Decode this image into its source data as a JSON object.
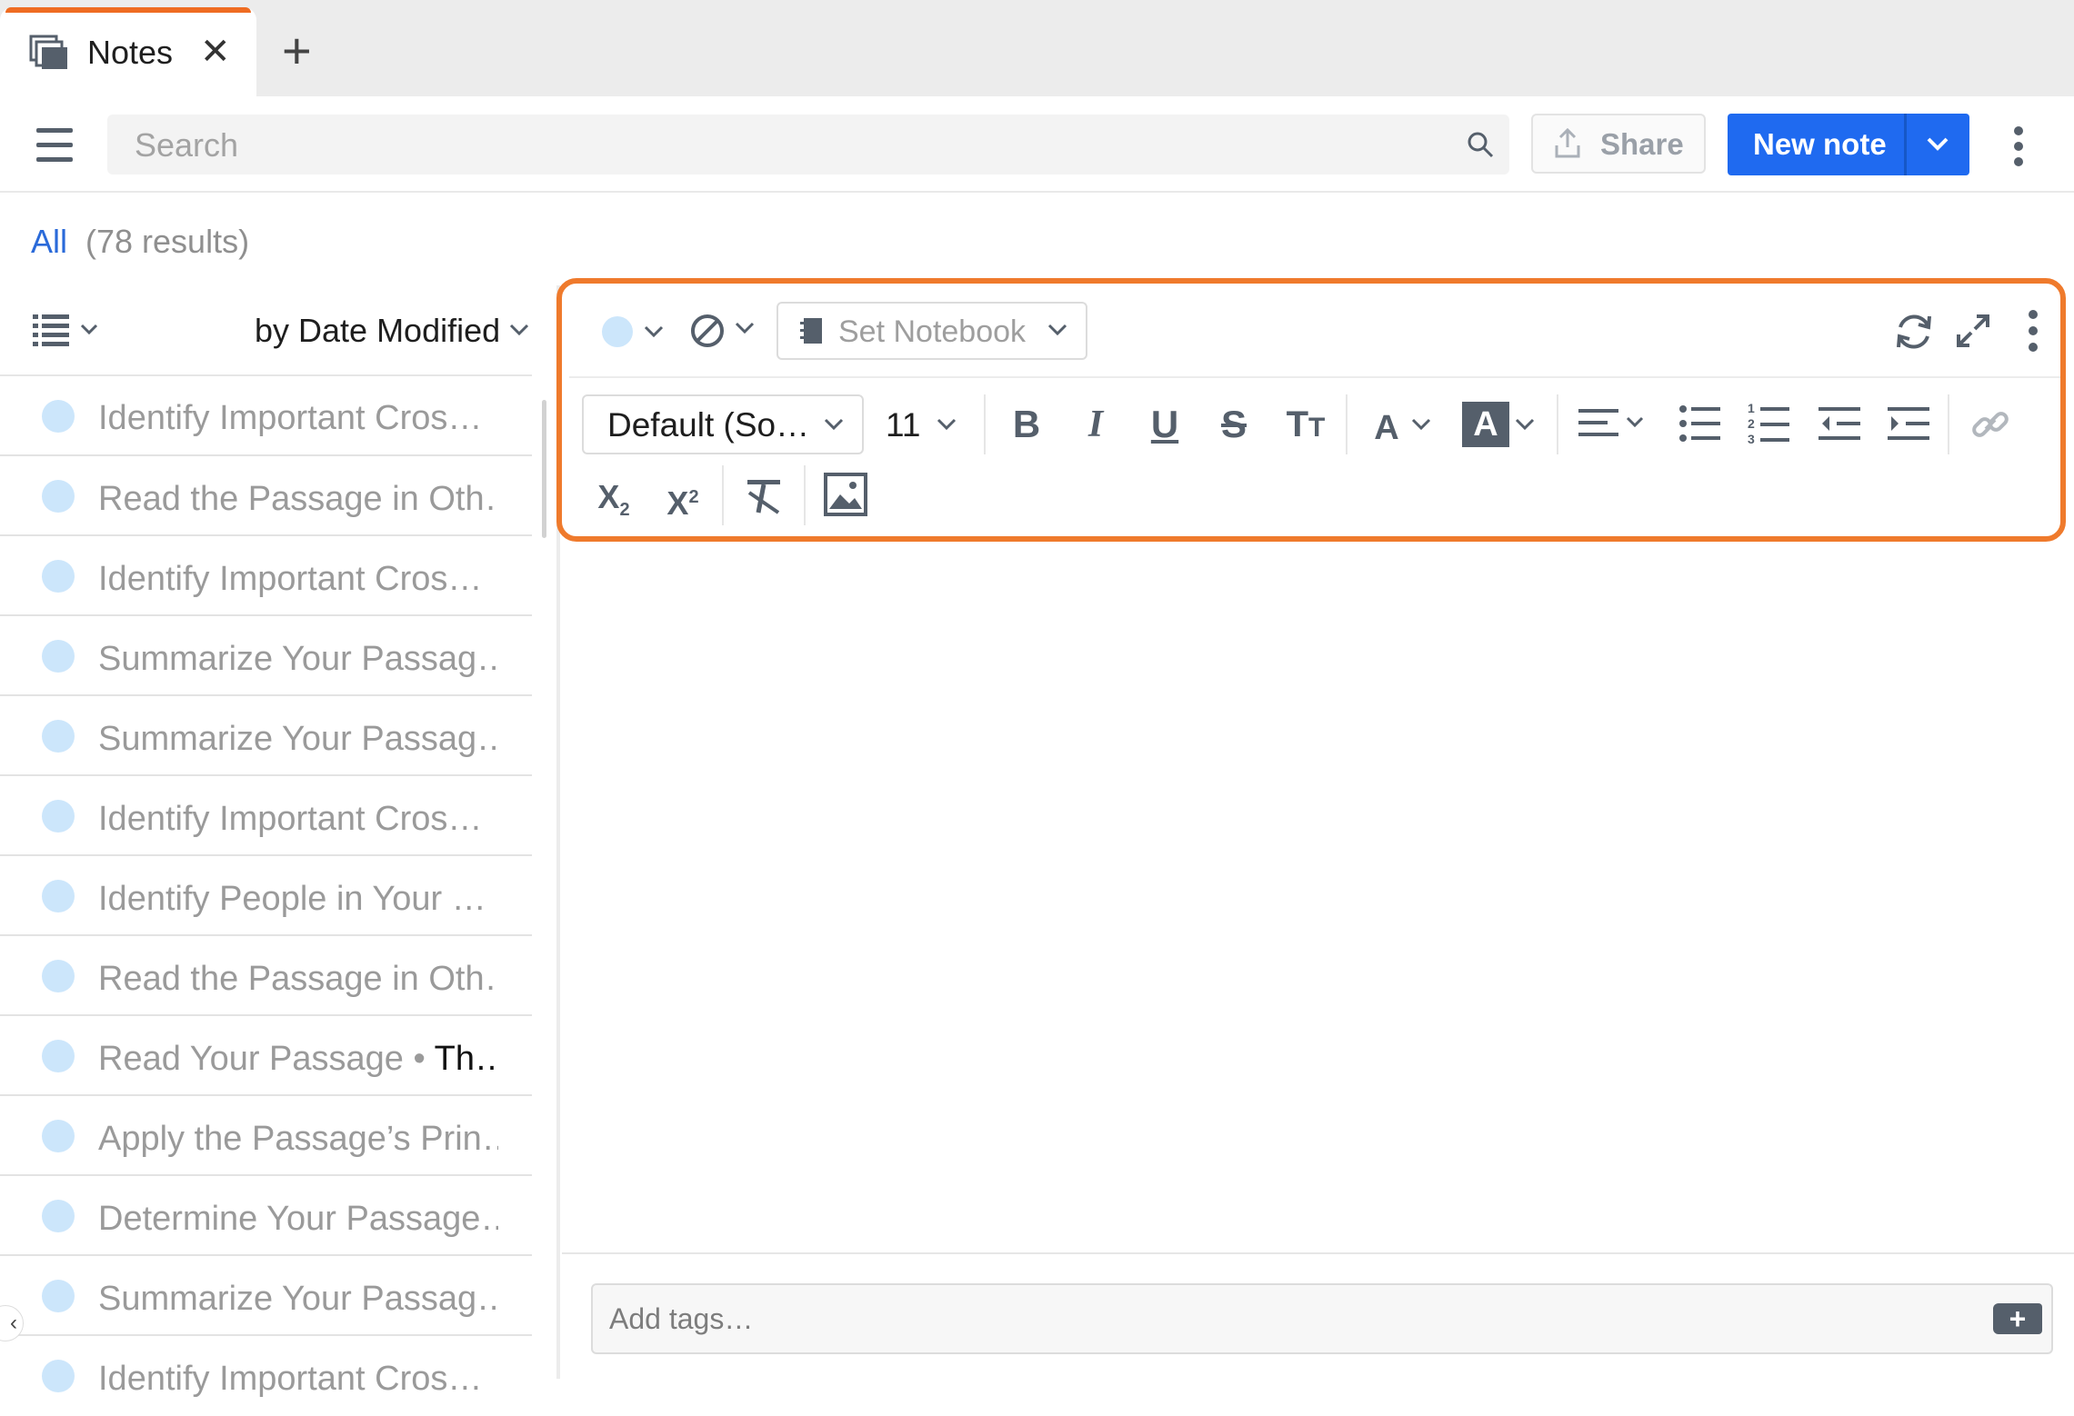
{
  "tab": {
    "label": "Notes",
    "close": "✕",
    "add": "+"
  },
  "toolbar": {
    "search_placeholder": "Search",
    "share_label": "Share",
    "new_note_label": "New note"
  },
  "filter": {
    "label": "All",
    "count": "(78 results)"
  },
  "list": {
    "sort_label": "by Date Modified",
    "notes": [
      {
        "title": "Identify Important Cros…"
      },
      {
        "title": "Read the Passage in Oth…"
      },
      {
        "title": "Identify Important Cros…"
      },
      {
        "title": "Summarize Your Passag…"
      },
      {
        "title": "Summarize Your Passag…"
      },
      {
        "title": "Identify Important Cros…"
      },
      {
        "title": "Identify People in Your …"
      },
      {
        "title": "Read the Passage in Oth…"
      },
      {
        "title": "Read Your Passage • ",
        "extra": "Th…"
      },
      {
        "title": "Apply the Passage’s Prin…"
      },
      {
        "title": "Determine Your Passage…"
      },
      {
        "title": "Summarize Your Passag…"
      },
      {
        "title": "Identify Important Cros…"
      }
    ]
  },
  "editor": {
    "notebook_placeholder": "Set Notebook",
    "font_family": "Default (So…",
    "font_size": "11",
    "tags_placeholder": "Add tags…"
  },
  "colors": {
    "accent": "#ef7a2c",
    "primary": "#1f6af0",
    "note_dot": "#cce6fb"
  }
}
